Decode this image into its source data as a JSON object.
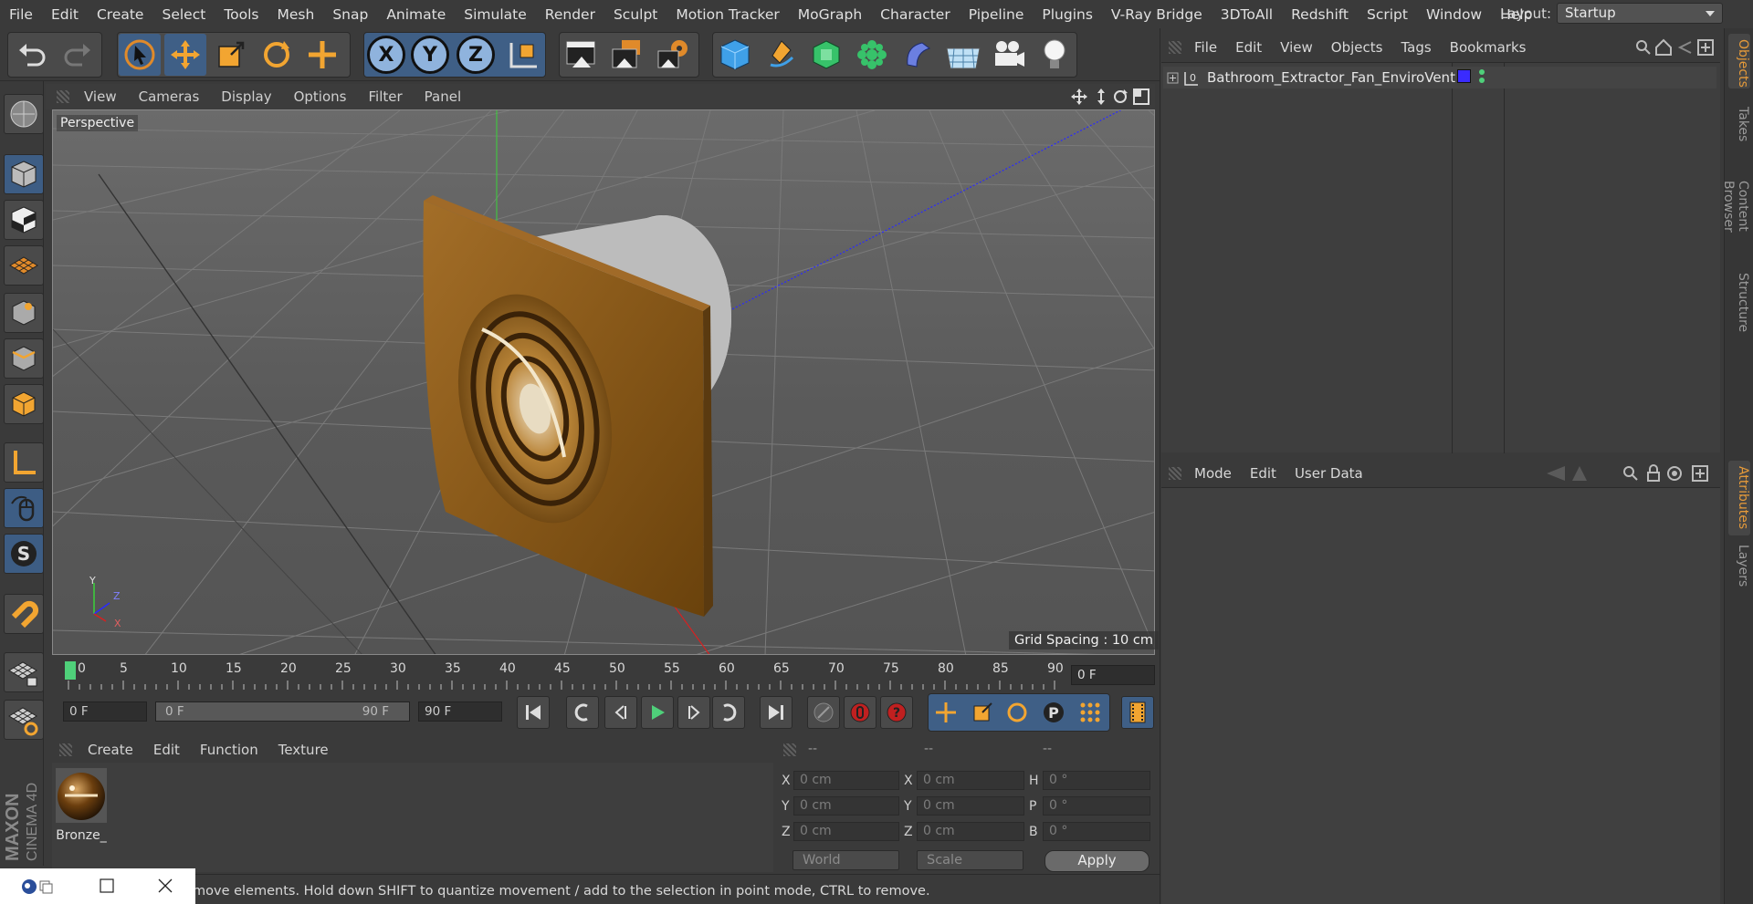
{
  "menubar": {
    "items": [
      "File",
      "Edit",
      "Create",
      "Select",
      "Tools",
      "Mesh",
      "Snap",
      "Animate",
      "Simulate",
      "Render",
      "Sculpt",
      "Motion Tracker",
      "MoGraph",
      "Character",
      "Pipeline",
      "Plugins",
      "V-Ray Bridge",
      "3DToAll",
      "Redshift",
      "Script",
      "Window",
      "Help"
    ],
    "layout_label": "Layout:",
    "layout_value": "Startup"
  },
  "toolbar": {
    "axis_x": "X",
    "axis_y": "Y",
    "axis_z": "Z"
  },
  "viewport": {
    "menu": [
      "View",
      "Cameras",
      "Display",
      "Options",
      "Filter",
      "Panel"
    ],
    "label": "Perspective",
    "grid_spacing": "Grid Spacing : 10 cm",
    "axis_y": "Y",
    "axis_z": "Z",
    "axis_x": "X"
  },
  "timeline": {
    "ticks": [
      "0",
      "5",
      "10",
      "15",
      "20",
      "25",
      "30",
      "35",
      "40",
      "45",
      "50",
      "55",
      "60",
      "65",
      "70",
      "75",
      "80",
      "85",
      "90"
    ],
    "current_frame": "0 F",
    "start_field": "0 F",
    "range_start": "0 F",
    "range_end": "90 F",
    "end_field": "90 F"
  },
  "materials": {
    "menu": [
      "Create",
      "Edit",
      "Function",
      "Texture"
    ],
    "items": [
      {
        "name": "Bronze_"
      }
    ]
  },
  "coordinates": {
    "headers": [
      "--",
      "--",
      "--"
    ],
    "pos": [
      {
        "axis": "X",
        "value": "0 cm"
      },
      {
        "axis": "Y",
        "value": "0 cm"
      },
      {
        "axis": "Z",
        "value": "0 cm"
      }
    ],
    "size": [
      {
        "axis": "X",
        "value": "0 cm"
      },
      {
        "axis": "Y",
        "value": "0 cm"
      },
      {
        "axis": "Z",
        "value": "0 cm"
      }
    ],
    "rot": [
      {
        "axis": "H",
        "value": "0 °"
      },
      {
        "axis": "P",
        "value": "0 °"
      },
      {
        "axis": "B",
        "value": "0 °"
      }
    ],
    "mode_world": "World",
    "mode_scale": "Scale",
    "apply": "Apply"
  },
  "object_manager": {
    "menu": [
      "File",
      "Edit",
      "View",
      "Objects",
      "Tags",
      "Bookmarks"
    ],
    "objects": [
      {
        "name": "Bathroom_Extractor_Fan_EnviroVent",
        "color": "#3a2bff"
      }
    ]
  },
  "attributes": {
    "menu": [
      "Mode",
      "Edit",
      "User Data"
    ]
  },
  "right_tabs": [
    "Objects",
    "Takes",
    "Content Browser",
    "Structure",
    "Attributes",
    "Layers"
  ],
  "status": {
    "text": "move elements. Hold down SHIFT to quantize movement / add to the selection in point mode, CTRL to remove."
  },
  "brand": {
    "maxon": "MAXON",
    "cinema": "CINEMA 4D"
  },
  "colors": {
    "accent_orange": "#e59a3a",
    "selected_blue": "#3f5f86",
    "playhead_green": "#4fd07a",
    "fan_bronze": "#8a5a1a"
  }
}
